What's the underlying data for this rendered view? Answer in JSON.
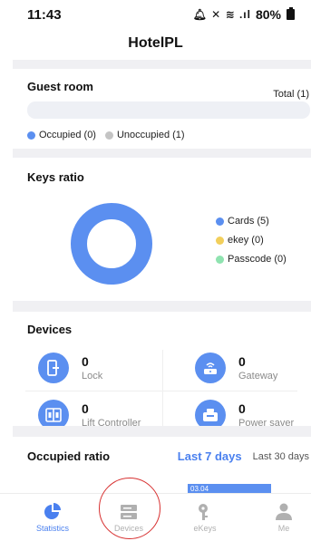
{
  "status_bar": {
    "time": "11:43",
    "indicators": "🔔︎ ✕ ≋ .ıl",
    "battery": "80%"
  },
  "app": {
    "title": "HotelPL"
  },
  "guest_room": {
    "title": "Guest room",
    "total": "Total (1)",
    "legend": [
      {
        "label": "Occupied (0)",
        "color": "#5b8ff0"
      },
      {
        "label": "Unoccupied (1)",
        "color": "#c4c4c4"
      }
    ]
  },
  "keys_ratio": {
    "title": "Keys ratio",
    "legend": [
      {
        "label": "Cards (5)",
        "color": "#5b8ff0"
      },
      {
        "label": "ekey (0)",
        "color": "#f2cf5b"
      },
      {
        "label": "Passcode (0)",
        "color": "#8fe3b0"
      }
    ]
  },
  "devices": {
    "title": "Devices",
    "items": [
      {
        "count": "0",
        "label": "Lock",
        "icon": "lock-icon"
      },
      {
        "count": "0",
        "label": "Gateway",
        "icon": "gateway-icon"
      },
      {
        "count": "0",
        "label": "Lift Controller",
        "icon": "lift-controller-icon"
      },
      {
        "count": "0",
        "label": "Power saver",
        "icon": "power-saver-icon"
      }
    ]
  },
  "occupied_ratio": {
    "title": "Occupied ratio",
    "tabs": [
      {
        "label": "Last 7 days",
        "active": true
      },
      {
        "label": "Last 30 days",
        "active": false
      }
    ],
    "bar_label": "03.04"
  },
  "bottom_nav": {
    "items": [
      {
        "label": "Statistics",
        "icon": "pie-chart-icon",
        "active": true
      },
      {
        "label": "Devices",
        "icon": "devices-icon",
        "active": false
      },
      {
        "label": "eKeys",
        "icon": "key-icon",
        "active": false
      },
      {
        "label": "Me",
        "icon": "person-icon",
        "active": false
      }
    ]
  },
  "colors": {
    "accent": "#4a80ef",
    "device_icon_bg": "#5b8ff0",
    "annotation": "#d73030"
  }
}
